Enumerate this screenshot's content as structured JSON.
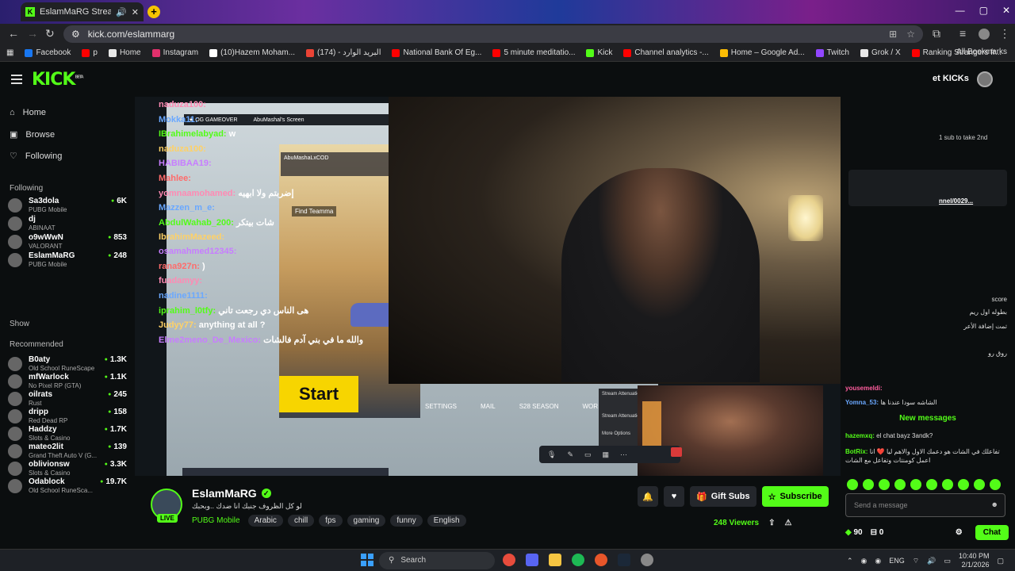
{
  "browser": {
    "tab_title": "EslamMaRG Stream - Watc",
    "url": "kick.com/eslammarg",
    "bookmarks": [
      "Facebook",
      "p",
      "Home",
      "Instagram",
      "(10)Hazem Moham...",
      "(174) - البريد الوارد",
      "National Bank Of Eg...",
      "5 minute meditatio...",
      "Kick",
      "Channel analytics -...",
      "Home – Google Ad...",
      "Twitch",
      "Grok / X",
      "Ranking Strangers fr..."
    ],
    "all_bookmarks": "All Bookmarks",
    "bookmark_colors": [
      "#1877f2",
      "#ff0000",
      "#e8e8e8",
      "#e1306c",
      "#ffffff",
      "#ea4335",
      "#ff0000",
      "#ff0000",
      "#53fc18",
      "#ff0000",
      "#fbbc04",
      "#9146ff",
      "#e8e8e8",
      "#ff0000"
    ]
  },
  "kick": {
    "logo": "KICK",
    "logo_beta": "BETA",
    "get_kicks": "et KICKs",
    "accent": "#53fc18"
  },
  "sidebar": {
    "nav": [
      {
        "label": "Home",
        "icon": "home-icon"
      },
      {
        "label": "Browse",
        "icon": "browse-icon"
      },
      {
        "label": "Following",
        "icon": "heart-icon"
      }
    ],
    "following_header": "Following",
    "following": [
      {
        "name": "Sa3dola",
        "game": "PUBG Mobile",
        "viewers": "6K"
      },
      {
        "name": "dj",
        "game": "ABINAAT",
        "viewers": ""
      },
      {
        "name": "o9wWwN",
        "game": "VALORANT",
        "viewers": "853"
      },
      {
        "name": "EslamMaRG",
        "game": "PUBG Mobile",
        "viewers": "248"
      }
    ],
    "recommended_header": "Recommended",
    "show_more": "Show",
    "recommended": [
      {
        "name": "B0aty",
        "game": "Old School RuneScape",
        "viewers": "1.3K"
      },
      {
        "name": "mfWarlock",
        "game": "No Pixel RP (GTA)",
        "viewers": "1.1K"
      },
      {
        "name": "oilrats",
        "game": "Rust",
        "viewers": "245"
      },
      {
        "name": "dripp",
        "game": "Red Dead RP",
        "viewers": "158"
      },
      {
        "name": "Haddzy",
        "game": "Slots & Casino",
        "viewers": "1.7K"
      },
      {
        "name": "mateo2lit",
        "game": "Grand Theft Auto V (G...",
        "viewers": "139"
      },
      {
        "name": "oblivionsw",
        "game": "Slots & Casino",
        "viewers": "3.3K"
      },
      {
        "name": "Odablock",
        "game": "Old School RuneSca...",
        "viewers": "19.7K"
      }
    ]
  },
  "player": {
    "overlay_header": "★ OG GAMEOVER",
    "overlay_screen": "AbuMashal's Screen",
    "pubg_user": "AbuMashaLxCOD",
    "find_team": "Find Teamma",
    "start_label": "Start",
    "menu": [
      "SETTINGS",
      "MAIL",
      "S28 SEASON",
      "WOR"
    ],
    "attention_title": "Stream Attenuation",
    "attention_strength": "Stream Attenuation Strength",
    "more_options": "More Options",
    "overlay_chat": [
      {
        "user": "naduza100:",
        "text": ""
      },
      {
        "user": "Mokka11:",
        "text": ""
      },
      {
        "user": "IBrahimelabyad:",
        "text": "w"
      },
      {
        "user": "naduza100:",
        "text": ""
      },
      {
        "user": "HABIBAA19:",
        "text": ""
      },
      {
        "user": "Mahlee:",
        "text": ""
      },
      {
        "user": "yomnaamohamed:",
        "text": "إضربتم ولا ابهيه"
      },
      {
        "user": "Mazzen_m_e:",
        "text": ""
      },
      {
        "user": "AbdulWahab_200:",
        "text": "شات بيتكر"
      },
      {
        "user": "IbrahimMazeed:",
        "text": ""
      },
      {
        "user": "osamahmed12345:",
        "text": ""
      },
      {
        "user": "rana927n:",
        "text": ")"
      },
      {
        "user": "fuadamyy:",
        "text": ""
      },
      {
        "user": "nadine1111:",
        "text": ""
      },
      {
        "user": "iprahim_l0tfy:",
        "text": "هى الناس دي رجعت تاني"
      },
      {
        "user": "Judyy77:",
        "text": "anything at all ?"
      },
      {
        "user": "Elme2meno_De_Mexico:",
        "text": "والله ما في بني آدم فالشات"
      }
    ]
  },
  "stream": {
    "channel": "EslamMaRG",
    "live": "LIVE",
    "title": "لو كل الظروف جنبك انا ضدك ..وبحبك",
    "category": "PUBG Mobile",
    "tags": [
      "Arabic",
      "chill",
      "fps",
      "gaming",
      "funny",
      "English"
    ],
    "gift_subs": "Gift Subs",
    "subscribe": "Subscribe",
    "viewers": "248 Viewers"
  },
  "chat": {
    "top_text": "1 sub to take 2nd",
    "pinned_link": "nnel/0029...",
    "side_snippets": [
      "score",
      "بطوله اول ريم",
      "تمت إضافة الأعر",
      "روق رو"
    ],
    "messages": [
      {
        "user": "yousemeldi:",
        "text": ""
      },
      {
        "user": "Yomna_53:",
        "text": "الشاشه سودا عندنا ها"
      }
    ],
    "new_messages": "New messages",
    "messages2": [
      {
        "user": "hazemxq:",
        "text": "el chat bayz 3andk?"
      },
      {
        "user": "BotRix:",
        "text": "تفاعلك في الشات هو دعمك الاول والاهم ليا ❤️ انا اعمل كومنتات وتفاعل مع الشات"
      }
    ],
    "placeholder": "Send a message",
    "points": "90",
    "count": "0",
    "chat_button": "Chat"
  },
  "taskbar": {
    "search": "Search",
    "lang": "ENG",
    "time": "10:40 PM",
    "date": "2/1/2026"
  }
}
